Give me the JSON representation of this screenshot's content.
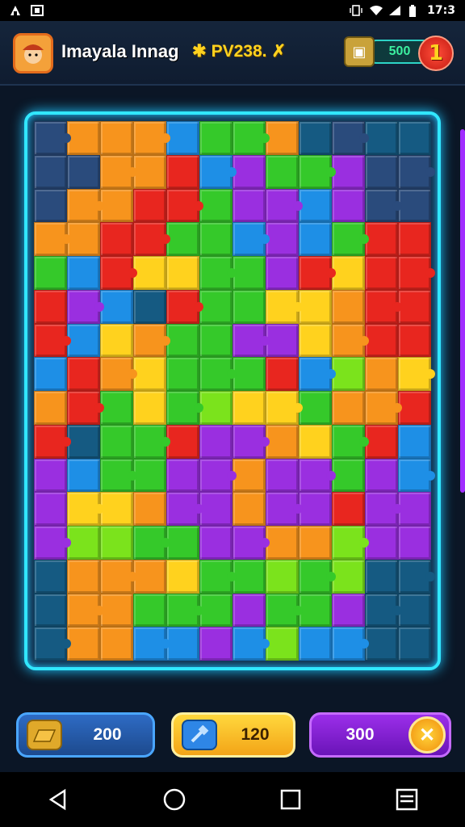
{
  "status_bar": {
    "time": "17:3",
    "left_icons": [
      "notification-a-icon",
      "image-icon"
    ],
    "right_icons": [
      "vibrate-icon",
      "wifi-icon",
      "signal-icon",
      "battery-icon"
    ]
  },
  "header": {
    "title": "Imayala Innag",
    "score_label": "PV238.",
    "coins": "500",
    "level": "1"
  },
  "board": {
    "palette": {
      "R": "#e8261f",
      "O": "#f7941d",
      "Y": "#ffd21e",
      "G": "#35c92a",
      "L": "#7be31c",
      "P": "#9a2fe0",
      "B": "#1e8fe6",
      "T": "#155a82",
      "N": "#2a4b7c"
    },
    "rows": [
      "NOOOBGGOTNTT",
      "NNOORBPGGPNN",
      "NOORRGPPBPNN",
      "OORRGGBPBGRR",
      "GBRYYGGPRYRR",
      "RPBTRGGYYORR",
      "RBYOGGPPYORR",
      "BROYGGGRBLOY",
      "ORGYGLYYGOOR",
      "RTGGRPPOYGRB",
      "PBGGPPOPPGPB",
      "PYYOPPOPPRPP",
      "PLLGGPPOOLPP",
      "TOOOYGGLGLTT",
      "TOOGGGPGGPTT",
      "TOOBBPBLBBTT"
    ]
  },
  "buttons": {
    "left_value": "200",
    "middle_value": "120",
    "right_value": "300"
  },
  "nav": [
    "back-icon",
    "home-icon",
    "recents-icon",
    "menu-icon"
  ]
}
